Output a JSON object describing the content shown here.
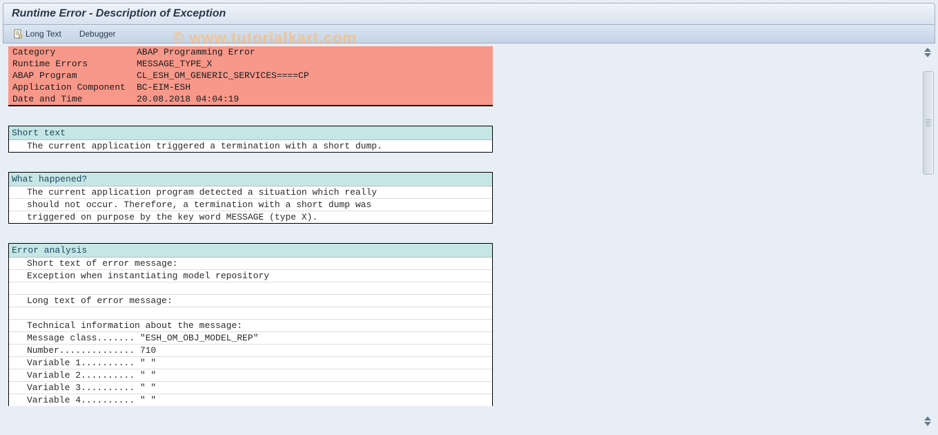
{
  "page_title": "Runtime Error - Description of Exception",
  "toolbar": {
    "long_text": "Long Text",
    "debugger": "Debugger"
  },
  "summary": {
    "rows": [
      {
        "label": "Category",
        "value": "ABAP Programming Error"
      },
      {
        "label": "Runtime Errors",
        "value": "MESSAGE_TYPE_X"
      },
      {
        "label": "ABAP Program",
        "value": "CL_ESH_OM_GENERIC_SERVICES====CP"
      },
      {
        "label": "Application Component",
        "value": "BC-EIM-ESH"
      },
      {
        "label": "Date and Time",
        "value": "20.08.2018 04:04:19"
      }
    ]
  },
  "sections": {
    "short_text": {
      "header": "Short text",
      "lines": [
        "The current application triggered a termination with a short dump."
      ]
    },
    "what_happened": {
      "header": "What happened?",
      "lines": [
        "The current application program detected a situation which really",
        "should not occur. Therefore, a termination with a short dump was",
        "triggered on purpose by the key word MESSAGE (type X)."
      ]
    },
    "error_analysis": {
      "header": "Error analysis",
      "lines": [
        "Short text of error message:",
        "Exception when instantiating model repository",
        "",
        "Long text of error message:",
        "",
        "Technical information about the message:",
        "Message class....... \"ESH_OM_OBJ_MODEL_REP\"",
        "Number.............. 710",
        "Variable 1.......... \" \"",
        "Variable 2.......... \" \"",
        "Variable 3.......... \" \"",
        "Variable 4.......... \" \""
      ]
    }
  },
  "watermark": "© www.tutorialkart.com"
}
